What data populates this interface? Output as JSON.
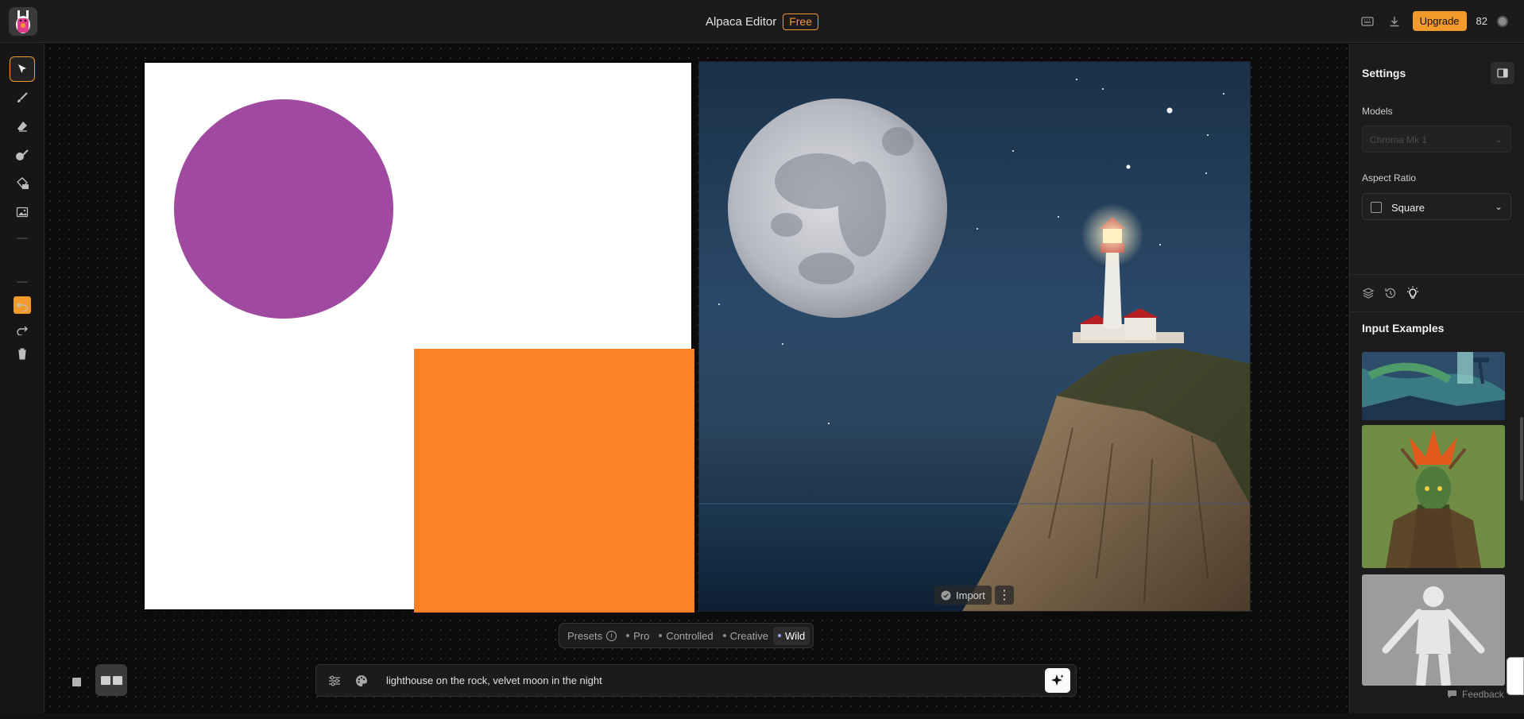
{
  "app": {
    "title": "Alpaca Editor",
    "plan_badge": "Free",
    "upgrade_label": "Upgrade",
    "credits": "82",
    "brand_color": "#f39a2d"
  },
  "toolbar": {
    "tools": [
      "select-tool",
      "brush-tool",
      "eraser-tool",
      "inpaint-tool",
      "fill-tool",
      "image-tool"
    ],
    "active_tool": "select-tool",
    "color": "#f39a2d"
  },
  "canvas": {
    "left_shapes": {
      "circle_color": "#a049a0",
      "rect_color": "#fd8128"
    },
    "import_label": "Import"
  },
  "presets": {
    "label": "Presets",
    "items": [
      "Pro",
      "Controlled",
      "Creative",
      "Wild"
    ],
    "selected": "Wild"
  },
  "prompt": {
    "text": "lighthouse on the rock, velvet moon in the night"
  },
  "settings": {
    "title": "Settings",
    "models_label": "Models",
    "model_value": "Chroma Mk 1",
    "aspect_label": "Aspect Ratio",
    "aspect_value": "Square",
    "input_examples_title": "Input Examples",
    "feedback_label": "Feedback"
  }
}
